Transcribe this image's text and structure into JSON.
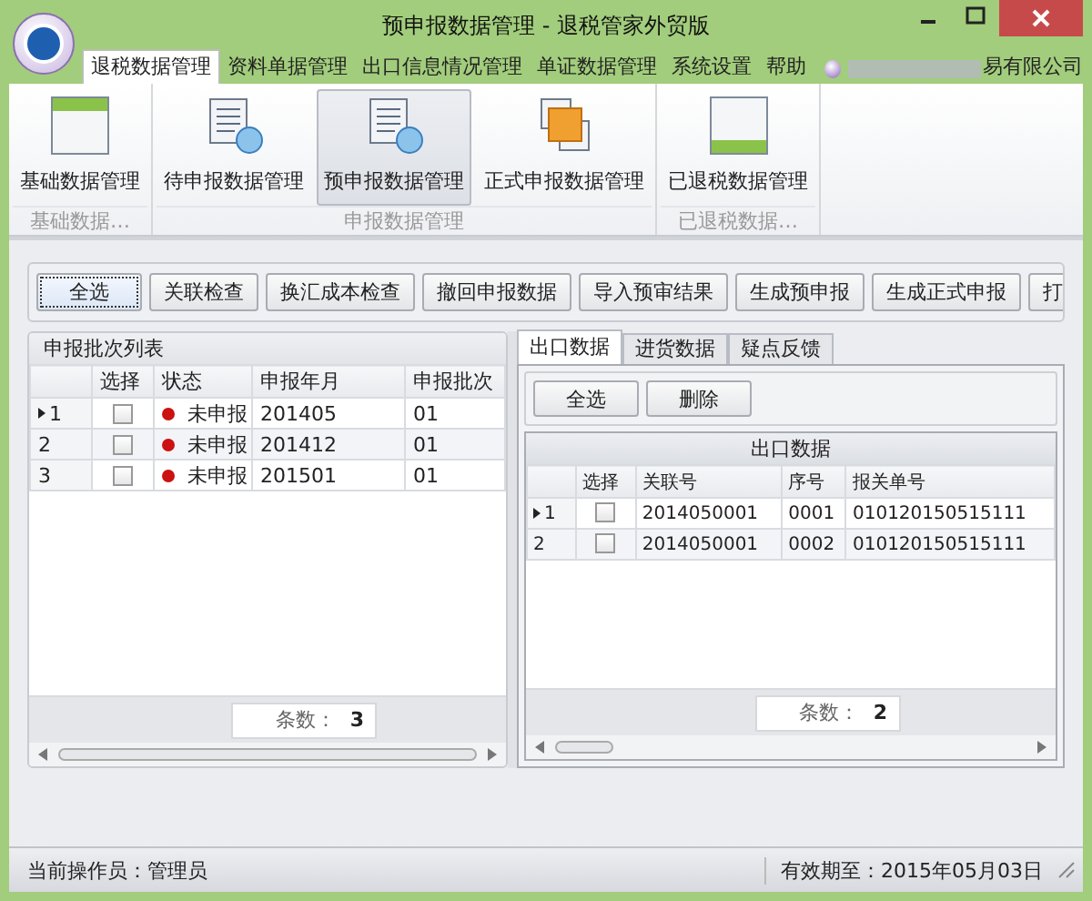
{
  "window": {
    "title": "预申报数据管理 - 退税管家外贸版"
  },
  "menu_tabs": [
    {
      "label": "退税数据管理",
      "selected": true
    },
    {
      "label": "资料单据管理",
      "selected": false
    },
    {
      "label": "出口信息情况管理",
      "selected": false
    },
    {
      "label": "单证数据管理",
      "selected": false
    },
    {
      "label": "系统设置",
      "selected": false
    },
    {
      "label": "帮助",
      "selected": false
    }
  ],
  "company": {
    "text": "易有限公司"
  },
  "ribbon": {
    "groups": [
      {
        "label": "基础数据…",
        "items": [
          {
            "label": "基础数据管理",
            "kind": "card-top",
            "selected": false
          }
        ]
      },
      {
        "label": "申报数据管理",
        "items": [
          {
            "label": "待申报数据管理",
            "kind": "doc",
            "selected": false
          },
          {
            "label": "预申报数据管理",
            "kind": "doc",
            "selected": true
          },
          {
            "label": "正式申报数据管理",
            "kind": "squares",
            "selected": false
          }
        ]
      },
      {
        "label": "已退税数据…",
        "items": [
          {
            "label": "已退税数据管理",
            "kind": "card-bottom",
            "selected": false
          }
        ]
      }
    ]
  },
  "toolbar": {
    "buttons": [
      {
        "label": "全选",
        "focused": true
      },
      {
        "label": "关联检查",
        "focused": false
      },
      {
        "label": "换汇成本检查",
        "focused": false
      },
      {
        "label": "撤回申报数据",
        "focused": false
      },
      {
        "label": "导入预审结果",
        "focused": false
      },
      {
        "label": "生成预申报",
        "focused": false
      },
      {
        "label": "生成正式申报",
        "focused": false
      },
      {
        "label": "打",
        "focused": false
      }
    ]
  },
  "batch_list": {
    "title": "申报批次列表",
    "columns": [
      "选择",
      "状态",
      "申报年月",
      "申报批次"
    ],
    "rows": [
      {
        "index": "1",
        "current": true,
        "checked": false,
        "status": "未申报",
        "color": "#cc1111",
        "year_month": "201405",
        "batch": "01"
      },
      {
        "index": "2",
        "current": false,
        "checked": false,
        "status": "未申报",
        "color": "#cc1111",
        "year_month": "201412",
        "batch": "01"
      },
      {
        "index": "3",
        "current": false,
        "checked": false,
        "status": "未申报",
        "color": "#cc1111",
        "year_month": "201501",
        "batch": "01"
      }
    ],
    "count_label": "条数：",
    "count": "3"
  },
  "detail": {
    "tabs": [
      {
        "label": "出口数据",
        "selected": true
      },
      {
        "label": "进货数据",
        "selected": false
      },
      {
        "label": "疑点反馈",
        "selected": false
      }
    ],
    "buttons": [
      "全选",
      "删除"
    ],
    "table_title": "出口数据",
    "columns": [
      "选择",
      "关联号",
      "序号",
      "报关单号"
    ],
    "rows": [
      {
        "index": "1",
        "current": true,
        "checked": false,
        "link_no": "2014050001",
        "seq": "0001",
        "declaration_no": "010120150515111"
      },
      {
        "index": "2",
        "current": false,
        "checked": false,
        "link_no": "2014050001",
        "seq": "0002",
        "declaration_no": "010120150515111"
      }
    ],
    "count_label": "条数：",
    "count": "2"
  },
  "status_bar": {
    "operator": "当前操作员：管理员",
    "expiry": "有效期至：2015年05月03日"
  }
}
